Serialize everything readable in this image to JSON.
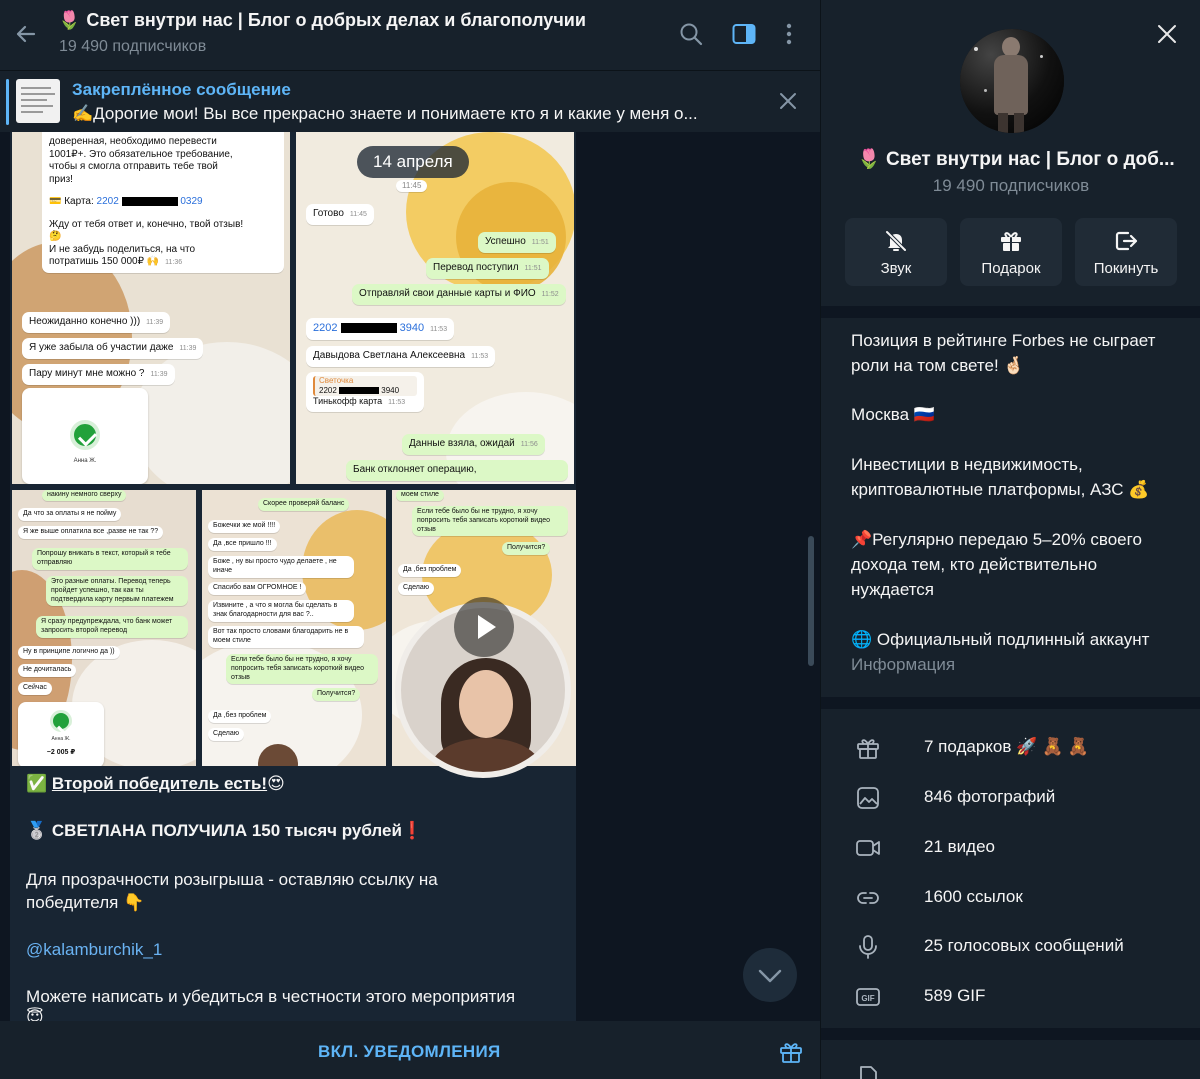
{
  "channel": {
    "title_emoji": "🌷",
    "title": "Свет внутри нас | Блог о добрых делах и благополучии",
    "title_short": "Свет внутри нас | Блог о доб...",
    "subscribers": "19 490 подписчиков"
  },
  "pinned": {
    "title": "Закреплённое сообщение",
    "text": "✍️Дорогие мои! Вы все прекрасно знаете и понимаете кто я и какие у меня о..."
  },
  "date_pill": "14 апреля",
  "screenshot1": {
    "lines": [
      "доверенная, необходимо перевести",
      "1001₽+. Это обязательное требование,",
      "чтобы я смогла отправить тебе твой",
      "приз!"
    ],
    "card_label": "💳 Карта: ",
    "card_start": "2202",
    "card_end": "0329",
    "wait_lines": [
      "Жду от тебя ответ и, конечно, твой отзыв!",
      "🤔",
      "И не забудь поделиться, на что",
      "потратишь 150 000₽ 🙌"
    ],
    "time1": "11:36",
    "m1": "Неожиданно конечно )))",
    "t1": "11:39",
    "m2": "Я уже забыла об участии даже",
    "t2": "11:39",
    "m3": "Пару минут мне можно ?",
    "t3": "11:39",
    "payee": "Анна Ж."
  },
  "screenshot2": {
    "t0": "11:45",
    "m1": "Готово",
    "t1": "11:45",
    "m2": "Успешно",
    "t2": "11:51",
    "m3": "Перевод поступил",
    "t3": "11:51",
    "m4": "Отправляй свои данные карты и ФИО",
    "t4": "11:52",
    "card_start": "2202",
    "card_end": "3940",
    "t5": "11:53",
    "m6": "Давыдова Светлана Алексеевна",
    "t6": "11:53",
    "quote_name": "Светочка",
    "quote_card_start": "2202",
    "quote_card_end": "3940",
    "m7": "Тинькофф карта",
    "t7": "11:53",
    "m8": "Данные взяла, ожидай",
    "t8": "11:56",
    "m9": "Банк отклоняет операцию,"
  },
  "screenshot3": {
    "items": [
      "накину немного сверху",
      "Да что за оплаты я не пойму",
      "Я же выше оплатила все ,разве не так ??",
      "Попрошу вникать в текст, который я тебе отправляю",
      "Это разные оплаты. Перевод теперь пройдет успешно, так как ты подтвердила карту первым платежем",
      "Я сразу предупреждала, что банк может запросить второй перевод",
      "Ну в принципе логично да ))",
      "Не дочиталась",
      "Сейчас"
    ],
    "payee": "Анна Ж.",
    "amount": "−2 005 ₽"
  },
  "screenshot4": {
    "items": [
      "Скорее проверяй баланс",
      "Божечки же мой !!!!",
      "Да ,все пришло !!!",
      "Боже , ну вы просто чудо делаете , не иначе",
      "Спасибо вам ОГРОМНОЕ !",
      "Извините , а что я могла бы сделать в знак благодарности для вас ?..",
      "Вот так просто словами благодарить не в моем стиле",
      "Если тебе было бы не трудно, я хочу попросить тебя записать короткий видео отзыв",
      "Получится?",
      "Да ,без проблем",
      "Сделаю"
    ]
  },
  "screenshot5": {
    "items": [
      "моем стиле",
      "Если тебе было бы не трудно, я хочу попросить тебя записать короткий видео отзыв",
      "Получится?",
      "Да ,без проблем",
      "Сделаю"
    ]
  },
  "message": {
    "winner_prefix": "✅ ",
    "winner_link": "Второй победитель есть!",
    "winner_emoji": "😍",
    "medal": "🥈",
    "received": " СВЕТЛАНА ПОЛУЧИЛА 150 тысяч рублей",
    "received_emoji": "❗",
    "transparency1": "Для прозрачности розыгрыша - оставляю ссылку на",
    "transparency2": "победителя 👇",
    "username": "@kalamburchik_1",
    "honesty": "Можете написать и убедиться в честности этого мероприятия",
    "honesty_emoji": "😇"
  },
  "bottom": {
    "notify": "ВКЛ. УВЕДОМЛЕНИЯ"
  },
  "info": {
    "actions": [
      {
        "label": "Звук",
        "icon": "muted-bell-icon"
      },
      {
        "label": "Подарок",
        "icon": "gift-icon"
      },
      {
        "label": "Покинуть",
        "icon": "leave-icon"
      }
    ],
    "desc1a": "Позиция в рейтинге Forbes не сыграет",
    "desc1b": "роли на том свете! 🤞🏻",
    "desc2": "Москва 🇷🇺",
    "desc3a": "Инвестиции в недвижимость,",
    "desc3b": "криптовалютные платформы, АЗС 💰",
    "desc4a": "📌Регулярно передаю 5–20% своего",
    "desc4b": "дохода тем, кто действительно",
    "desc4c": "нуждается",
    "desc5": "🌐 Официальный подлинный аккаунт",
    "desc_label": "Информация",
    "media": [
      {
        "label": "7 подарков 🚀 🧸 🧸",
        "icon": "gift-icon"
      },
      {
        "label": "846 фотографий",
        "icon": "photo-icon"
      },
      {
        "label": "21 видео",
        "icon": "video-icon"
      },
      {
        "label": "1600 ссылок",
        "icon": "link-icon"
      },
      {
        "label": "25 голосовых сообщений",
        "icon": "microphone-icon"
      },
      {
        "label": "589 GIF",
        "icon": "gif-icon"
      }
    ],
    "gif_badge": "GIF"
  },
  "colors": {
    "accent": "#5eb5f7",
    "link": "#6ab3f3",
    "panel": "#17212b",
    "background": "#0e1621",
    "bubble": "#182533",
    "muted": "#7f8b96"
  }
}
